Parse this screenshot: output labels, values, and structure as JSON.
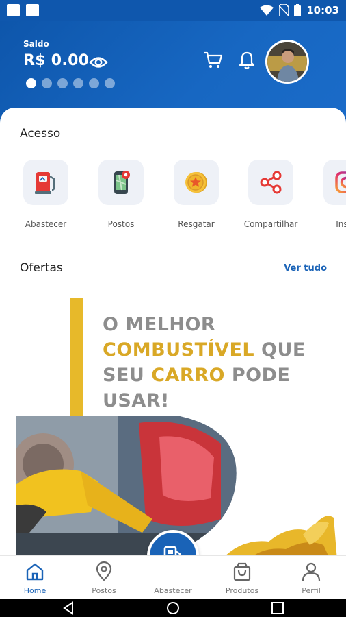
{
  "status": {
    "time": "10:03"
  },
  "header": {
    "balance_label": "Saldo",
    "balance_value": "R$ 0.00",
    "carousel_dots": 6,
    "active_dot": 0
  },
  "acesso": {
    "title": "Acesso",
    "items": [
      {
        "label": "Abastecer",
        "icon": "fuel-pump-icon"
      },
      {
        "label": "Postos",
        "icon": "map-phone-icon"
      },
      {
        "label": "Resgatar",
        "icon": "coin-star-icon"
      },
      {
        "label": "Compartilhar",
        "icon": "share-icon"
      },
      {
        "label": "Insta",
        "icon": "instagram-icon"
      }
    ]
  },
  "ofertas": {
    "title": "Ofertas",
    "see_all": "Ver tudo",
    "banner": {
      "line1": "O MELHOR",
      "line2_highlight": "COMBUSTÍVEL",
      "line2_rest": " QUE",
      "line3_pre": "SEU ",
      "line3_highlight": "CARRO",
      "line3_rest": " PODE",
      "line4": "USAR!"
    }
  },
  "bottom_nav": {
    "items": [
      {
        "label": "Home",
        "icon": "home-icon",
        "active": true
      },
      {
        "label": "Postos",
        "icon": "location-pin-icon"
      },
      {
        "label": "Abastecer",
        "icon": "fuel-pump-icon"
      },
      {
        "label": "Produtos",
        "icon": "shopping-bag-icon"
      },
      {
        "label": "Perfil",
        "icon": "person-icon"
      }
    ]
  },
  "colors": {
    "primary": "#1a63b7",
    "accent": "#e7b92a",
    "text_gray": "#8d8d8d"
  }
}
